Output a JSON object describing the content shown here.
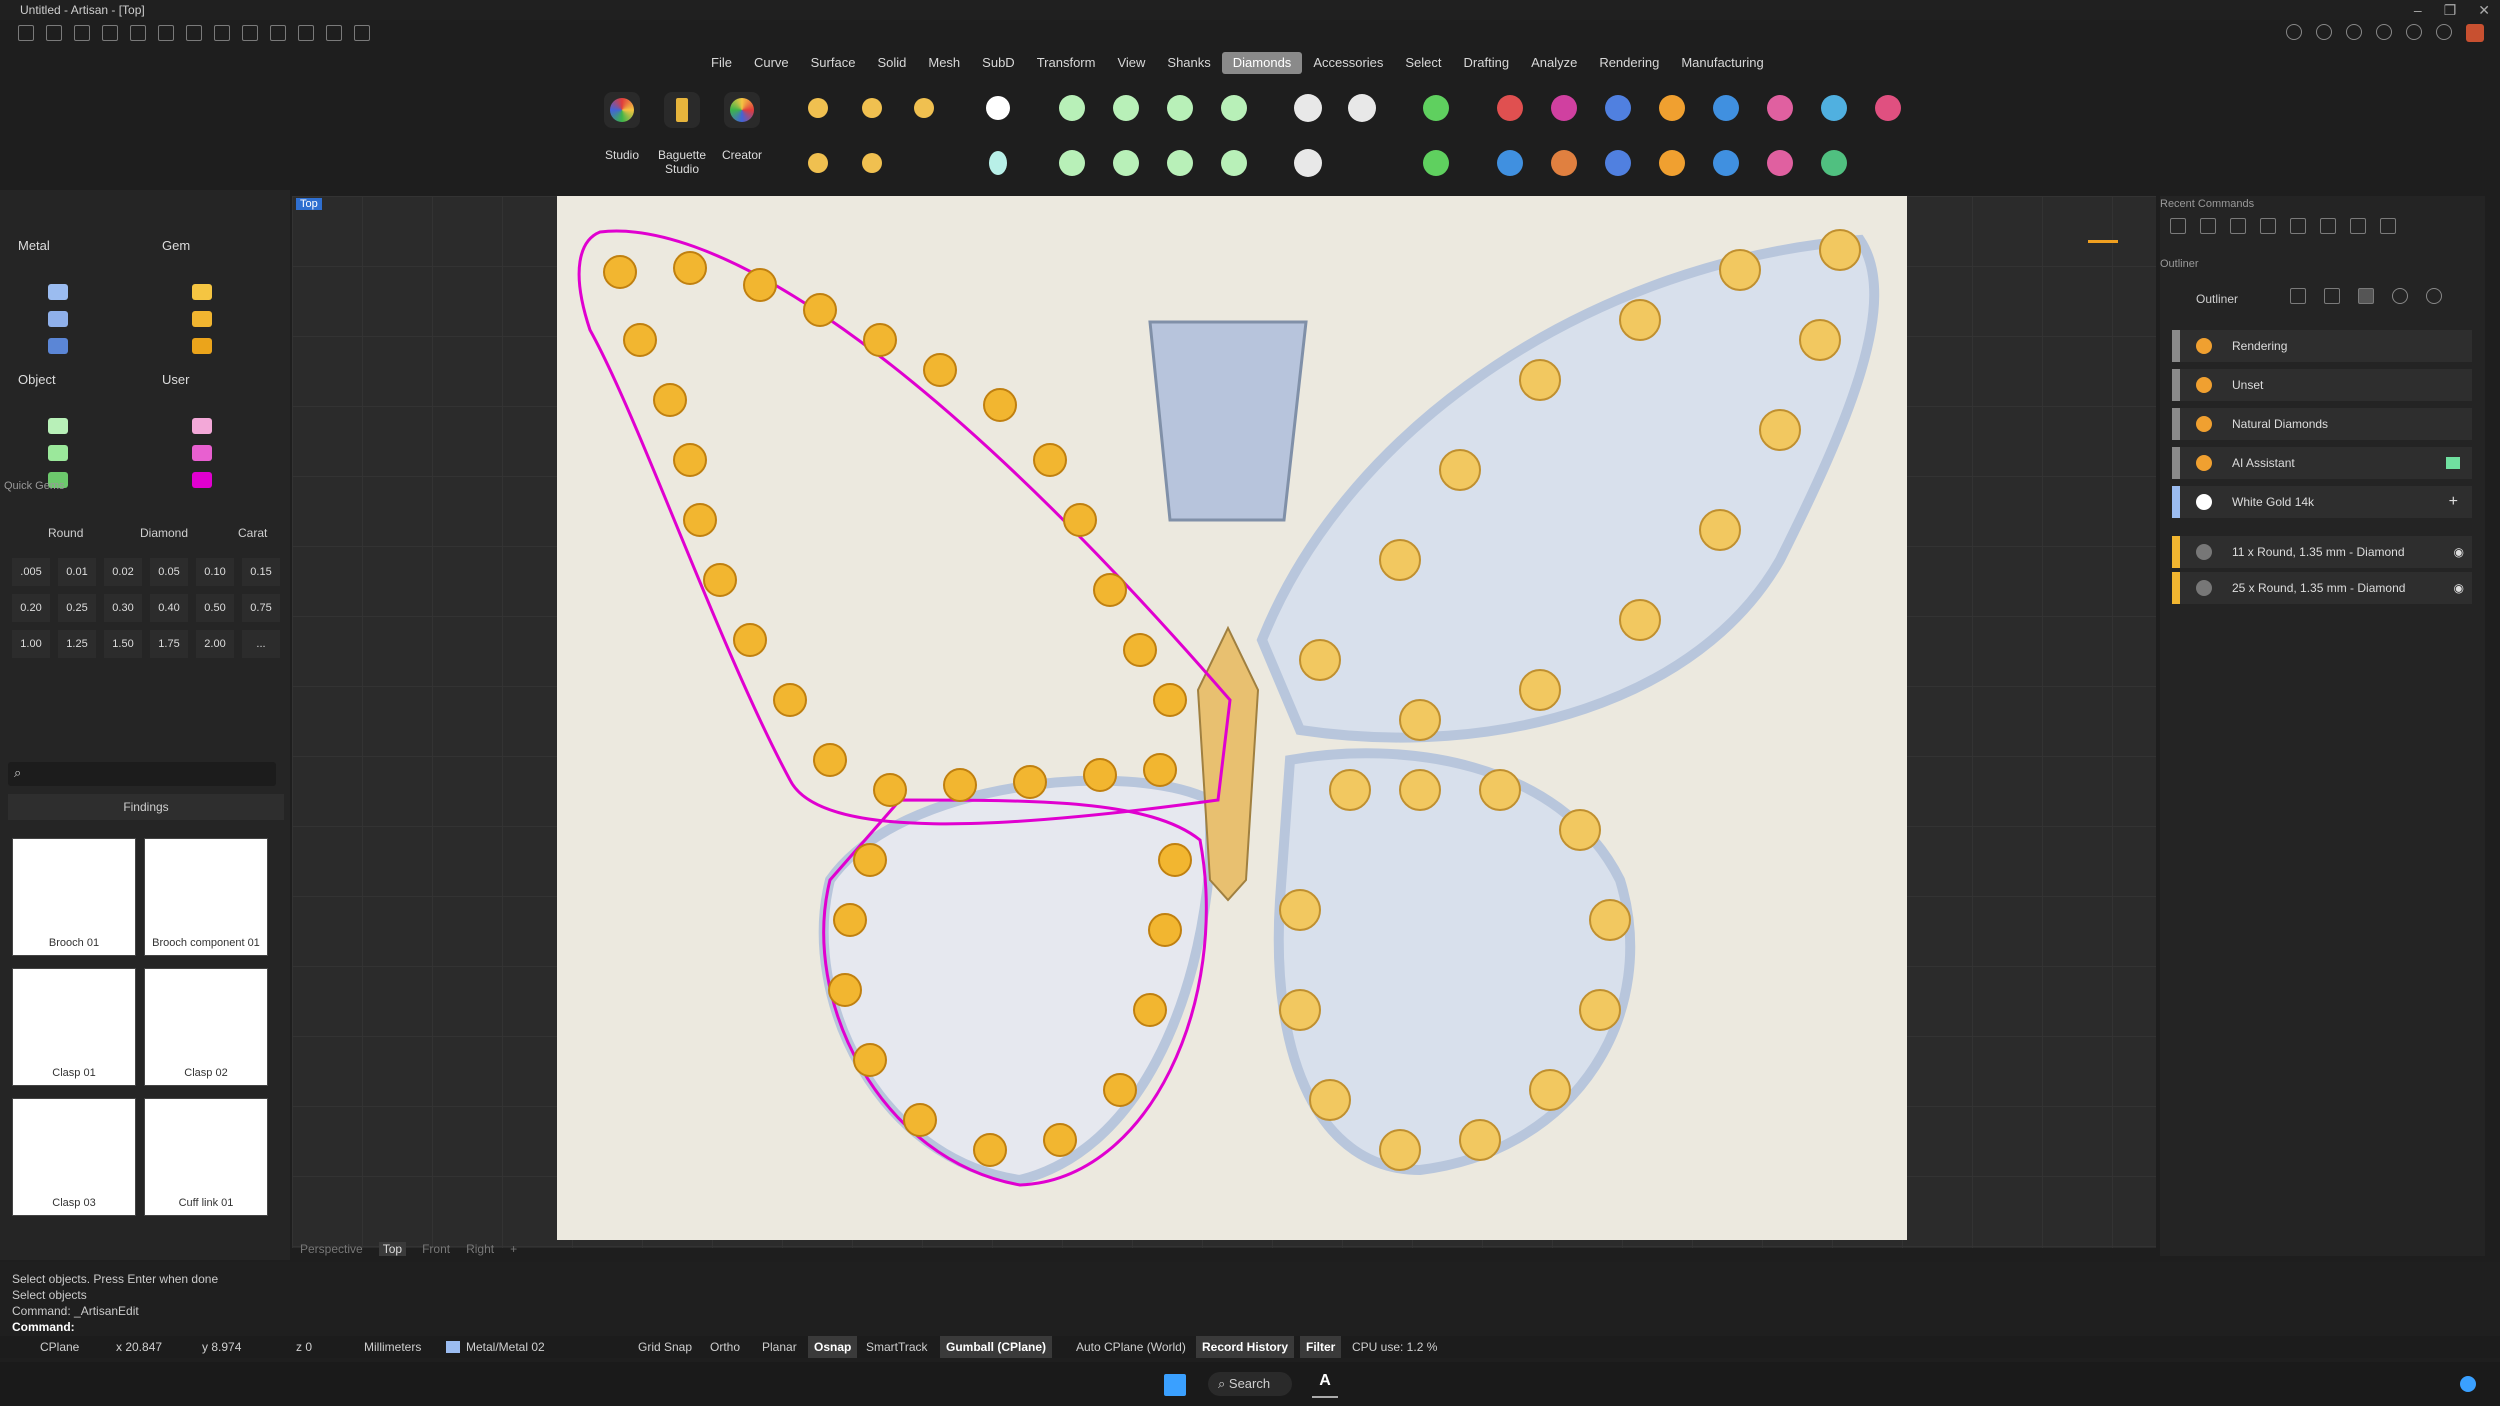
{
  "app": {
    "title": "Untitled - Artisan - [Top]"
  },
  "menu": [
    "File",
    "Curve",
    "Surface",
    "Solid",
    "Mesh",
    "SubD",
    "Transform",
    "View",
    "Shanks",
    "Diamonds",
    "Accessories",
    "Select",
    "Drafting",
    "Analyze",
    "Rendering",
    "Manufacturing"
  ],
  "menu_active": "Diamonds",
  "ribbon": {
    "studio": "Studio",
    "baguette": "Baguette Studio",
    "creator": "Creator"
  },
  "layers": {
    "metal": "Metal",
    "gem": "Gem",
    "object": "Object",
    "user": "User",
    "metal_colors": [
      "#9bbcf0",
      "#8fb0ea",
      "#5b86d6"
    ],
    "gem_colors": [
      "#f5c542",
      "#f1b530",
      "#eba41b"
    ],
    "object_colors": [
      "#b8f0b8",
      "#9be89b",
      "#6cc96c"
    ],
    "user_colors": [
      "#f3a8d8",
      "#e860d0",
      "#e000d0"
    ]
  },
  "quick_gems": {
    "title": "Quick Gems",
    "shape": "Round",
    "material": "Diamond",
    "unit": "Carat",
    "sizes": [
      ".005",
      "0.01",
      "0.02",
      "0.05",
      "0.10",
      "0.15",
      "0.20",
      "0.25",
      "0.30",
      "0.40",
      "0.50",
      "0.75",
      "1.00",
      "1.25",
      "1.50",
      "1.75",
      "2.00",
      "..."
    ]
  },
  "library": {
    "category": "Findings",
    "items": [
      "Brooch 01",
      "Brooch component 01",
      "Clasp 01",
      "Clasp 02",
      "Clasp 03",
      "Cuff link 01"
    ]
  },
  "viewport": {
    "label": "Top",
    "tabs": [
      "Perspective",
      "Top",
      "Front",
      "Right"
    ],
    "active_tab": "Top"
  },
  "right": {
    "recent_commands": "Recent Commands",
    "outliner_section": "Outliner",
    "outliner_title": "Outliner",
    "rows": [
      {
        "label": "Rendering",
        "color": "#8a8a8a"
      },
      {
        "label": "Unset",
        "color": "#8a8a8a"
      },
      {
        "label": "Natural Diamonds",
        "color": "#8a8a8a"
      },
      {
        "label": "AI Assistant",
        "color": "#8a8a8a"
      },
      {
        "label": "White Gold 14k",
        "color": "#9bbcf0"
      }
    ],
    "gem_rows": [
      {
        "label": "11 x Round, 1.35 mm - Diamond",
        "color": "#f1b530"
      },
      {
        "label": "25 x Round, 1.35 mm - Diamond",
        "color": "#f1b530"
      }
    ]
  },
  "command": {
    "lines": [
      "Select objects. Press Enter when done",
      "Select objects",
      "Command: _ArtisanEdit"
    ],
    "prompt": "Command:"
  },
  "status": {
    "cplane": "CPlane",
    "x": "x 20.847",
    "y": "y 8.974",
    "z": "z 0",
    "units": "Millimeters",
    "layer": "Metal/Metal 02",
    "grid_snap": "Grid Snap",
    "ortho": "Ortho",
    "planar": "Planar",
    "osnap": "Osnap",
    "smarttrack": "SmartTrack",
    "gumball": "Gumball (CPlane)",
    "auto_cplane": "Auto CPlane (World)",
    "record_history": "Record History",
    "filter": "Filter",
    "cpu": "CPU use: 1.2 %"
  },
  "taskbar": {
    "search": "Search"
  }
}
